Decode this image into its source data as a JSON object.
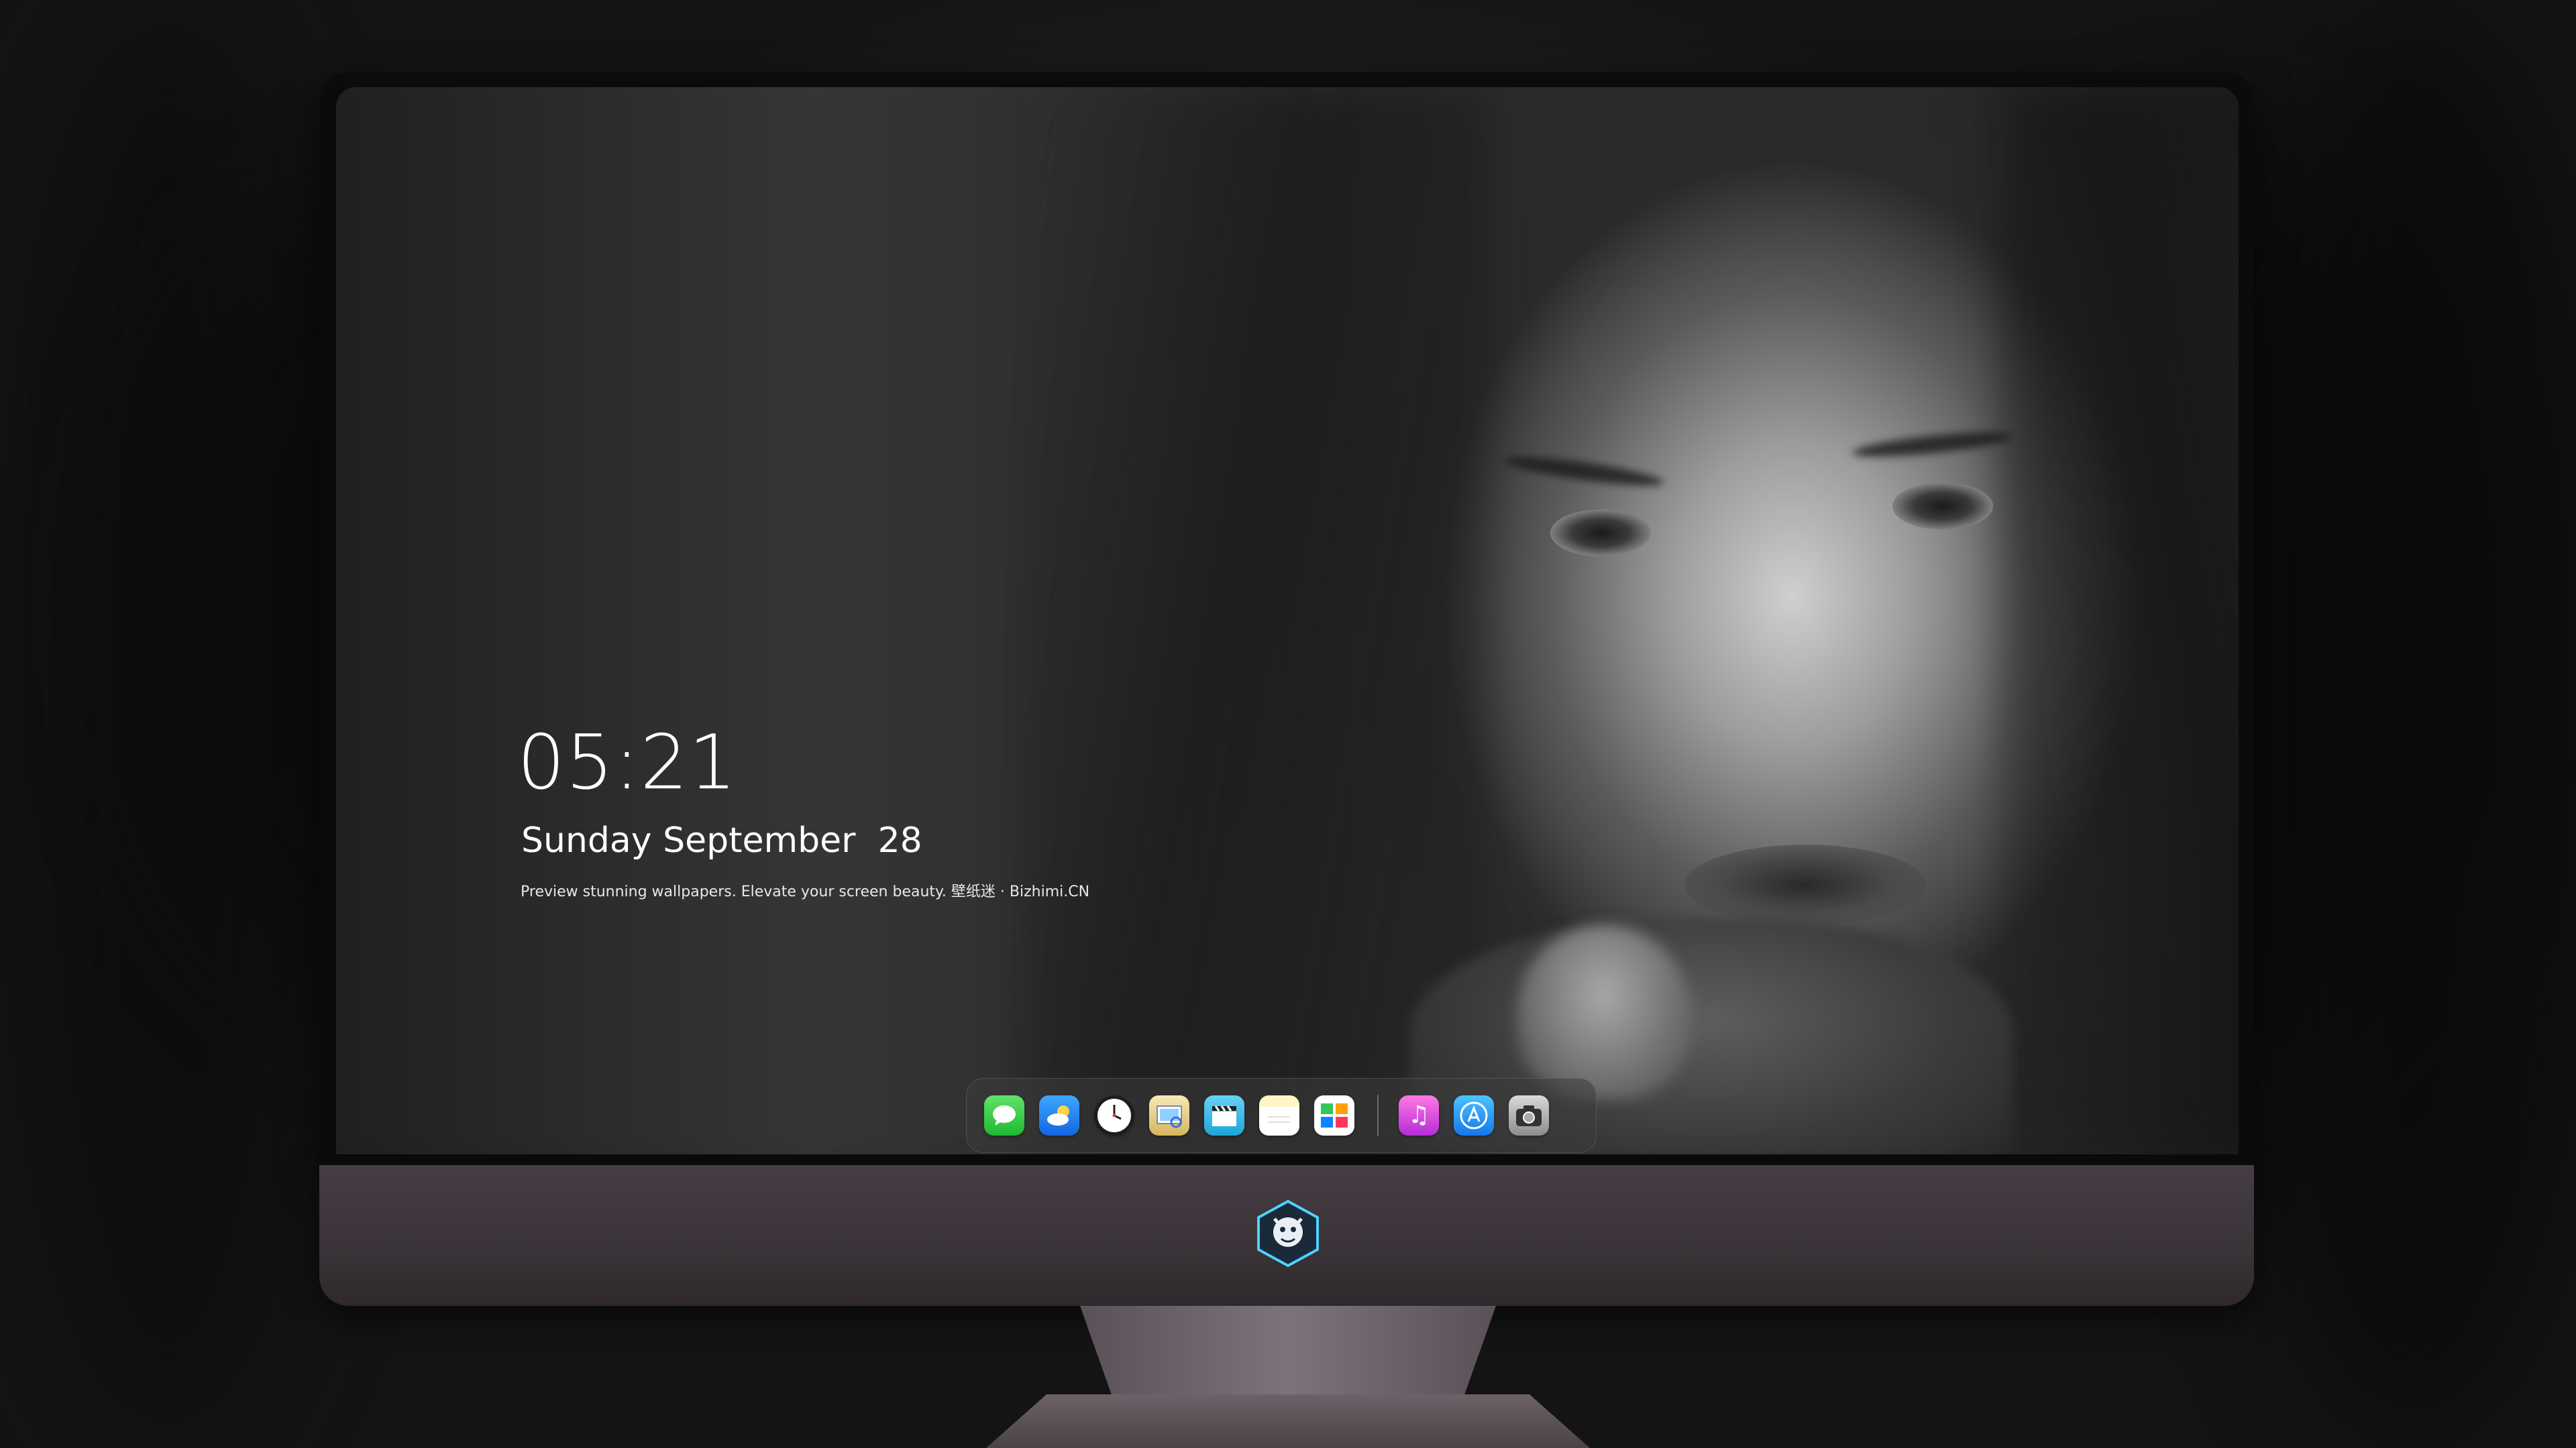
{
  "lockscreen": {
    "time": "05:21",
    "date": "Sunday September  28",
    "tagline": "Preview stunning wallpapers. Elevate your screen beauty. 壁纸迷 · Bizhimi.CN"
  },
  "dock": {
    "apps": [
      {
        "name": "messages-icon",
        "glyph": "💬"
      },
      {
        "name": "weather-icon",
        "glyph": "☁"
      },
      {
        "name": "clock-icon",
        "glyph": "🕓"
      },
      {
        "name": "preview-icon",
        "glyph": "🖼"
      },
      {
        "name": "video-clapper-icon",
        "glyph": "🎬"
      },
      {
        "name": "notes-icon",
        "glyph": ""
      },
      {
        "name": "photos-icon",
        "glyph": "▦"
      },
      {
        "name": "music-icon",
        "glyph": "♫"
      },
      {
        "name": "app-store-icon",
        "glyph": "A"
      },
      {
        "name": "camera-icon",
        "glyph": "📷"
      }
    ]
  },
  "colors": {
    "dock_bg": "#3c3c3c",
    "chin": "#413a3f",
    "text": "#ffffff"
  }
}
